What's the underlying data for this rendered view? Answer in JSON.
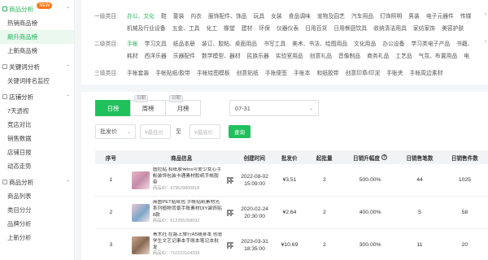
{
  "sidebar": {
    "groups": [
      {
        "title": "商品分析",
        "badge": "NEW",
        "active": true,
        "items": [
          "热销商品榜",
          "飙升商品榜",
          "上新商品榜"
        ],
        "active_item": 1
      },
      {
        "title": "关键词分析",
        "items": [
          "关键词排名监控"
        ]
      },
      {
        "title": "店铺分析",
        "items": [
          "7天透视",
          "竞店对比",
          "销售数据",
          "店铺日报",
          "动态走势"
        ]
      },
      {
        "title": "商品分析",
        "items": [
          "商品列表",
          "类目分分",
          "品牌分析",
          "上新分析"
        ]
      }
    ]
  },
  "filters": {
    "level1": {
      "label": "一级类目:",
      "options": [
        "办公、文化",
        "鞋",
        "童装",
        "内衣",
        "服饰配件、饰品",
        "玩具",
        "女装",
        "食品调味",
        "宠物及园艺",
        "汽车用品",
        "灯饰照明",
        "男装",
        "电子元器件",
        "传媒",
        "机械及行业设备",
        "五金、工具",
        "化工",
        "橡塑",
        "建材",
        "环保",
        "仪器仪表",
        "日用百货",
        "日用餐厨饮具",
        "收纳清洁用具",
        "家纺家饰",
        "美容护肤"
      ],
      "active": 0
    },
    "level2": {
      "label": "二级类目:",
      "options": [
        "手帐",
        "学习文具",
        "纸品本册",
        "装订、胶粘、桌面用品",
        "书写工具",
        "美术、书法、绘图用品",
        "文化用品",
        "办公设备",
        "学习类电子产品",
        "书籍、",
        "耗材",
        "西洋乐器",
        "乐器配件",
        "数学模型、器材",
        "民族乐器",
        "实验室用品",
        "创意礼品",
        "音像制品",
        "商务礼品",
        "工艺品",
        "气氛、布置用品",
        "电"
      ],
      "active": 0
    },
    "level3": {
      "label": "三级类目:",
      "options": [
        "手帐套装",
        "手帐贴纸/胶带",
        "手帐绘图模板",
        "创意贴纸",
        "手账便签",
        "手账本",
        "和纸胶带",
        "创意印章/印泥",
        "手账夹",
        "手帐周边素材"
      ],
      "active": -1
    }
  },
  "toolbar": {
    "tabs": [
      {
        "label": "日榜",
        "tag": ""
      },
      {
        "label": "周榜",
        "tag": "日期"
      },
      {
        "label": "月榜",
        "tag": "日期"
      }
    ],
    "date_value": "07-31",
    "price_select": "批发价",
    "price_min_placeholder": "¥最低价",
    "price_max_placeholder": "¥最高价",
    "price_sep": "至",
    "query_label": "查询"
  },
  "table": {
    "headers": [
      "序号",
      "商品信息",
      "创建时间",
      "批发价",
      "起批量",
      "日销升幅度",
      "日销售笔数",
      "日销售件数"
    ],
    "rows": [
      {
        "idx": "1",
        "title": "图拉贴 和纸胶带ins可爱少女心手帐装饰包装卡通素材胶纸手帐胶带",
        "id": "商品ID：679629800818",
        "date": "2022-08-02",
        "time": "15:09:00",
        "price": "¥3.51",
        "qty": "2",
        "rate": "500.00%",
        "orders": "44",
        "pieces": "1025"
      },
      {
        "idx": "2",
        "title": "简图PET贴纸包 手帐贴纸素材光系列植物背景手账素材DIY装饰贴 8款",
        "id": "商品ID：612255268092",
        "date": "2020-02-24",
        "time": "20:30:00",
        "price": "¥2.64",
        "qty": "2",
        "rate": "400.00%",
        "orders": "5",
        "pieces": "58"
      },
      {
        "idx": "3",
        "title": "青木社 在路上旅行A5随身本 创意学生文艺记事本手账本笔记本批发",
        "id": "商品ID：710153104339",
        "date": "2023-03-31",
        "time": "18:35:00",
        "price": "¥10.69",
        "qty": "2",
        "rate": "300.00%",
        "orders": "11",
        "pieces": "20"
      }
    ]
  },
  "colors": {
    "accent": "#20c05c",
    "badge": "#ff7a1a"
  }
}
